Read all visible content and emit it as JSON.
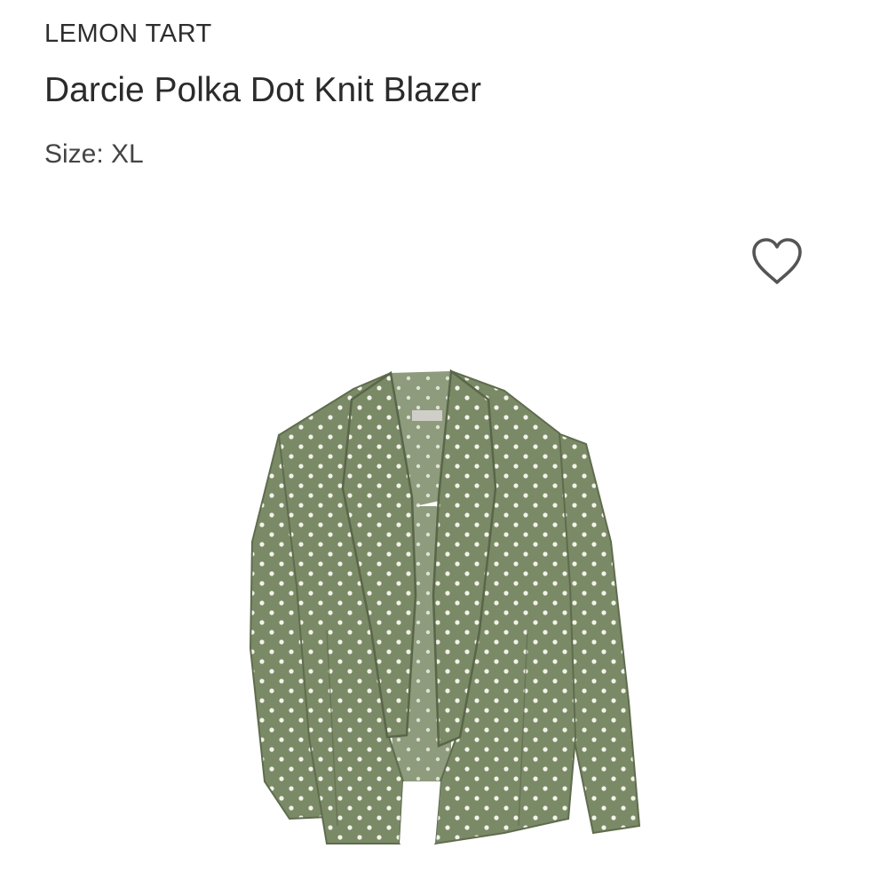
{
  "product": {
    "brand": "LEMON TART",
    "name": "Darcie Polka Dot Knit Blazer",
    "size_label": "Size: XL"
  },
  "favorite": {
    "icon": "heart-outline-icon",
    "color": "#555555"
  },
  "image": {
    "subject": "olive-green-polka-dot-blazer",
    "fabric_color": "#7b8a66",
    "dot_color": "#f3f3ea"
  }
}
